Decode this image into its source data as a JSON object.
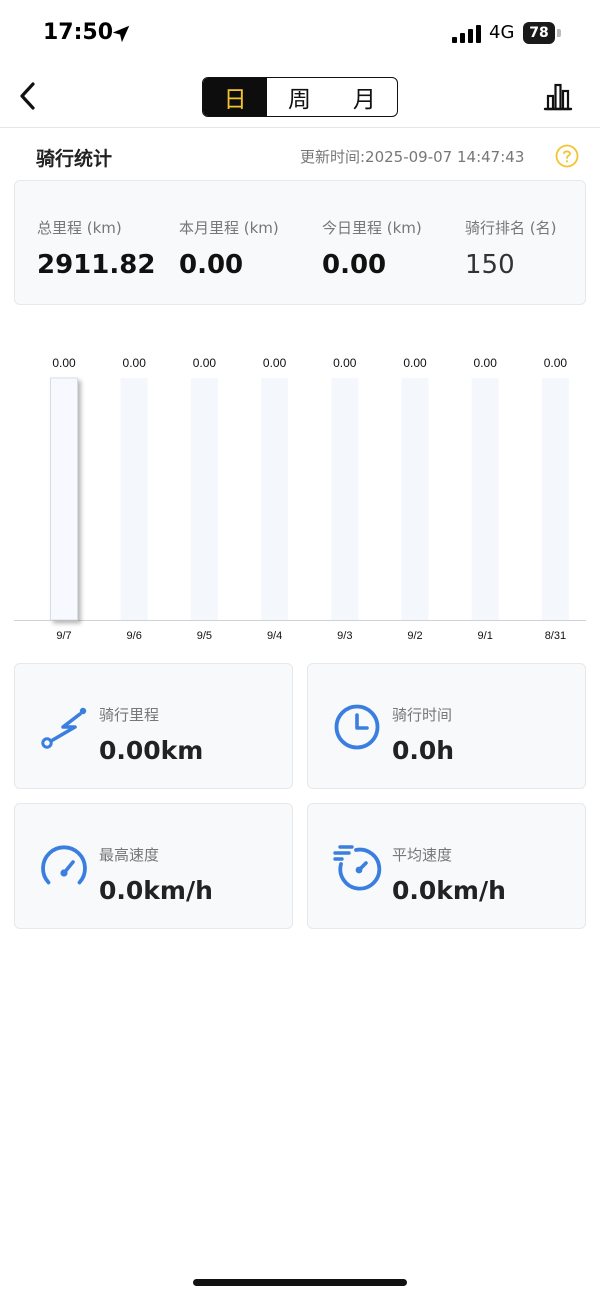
{
  "status_bar": {
    "time": "17:50",
    "network": "4G",
    "battery": "78"
  },
  "nav": {
    "tabs": [
      {
        "label": "日",
        "active": true
      },
      {
        "label": "周",
        "active": false
      },
      {
        "label": "月",
        "active": false
      }
    ],
    "icons": {
      "back": "chevron-left-icon",
      "stats": "bar-chart-icon"
    }
  },
  "header": {
    "title": "骑行统计",
    "update_time": "更新时间:2025-09-07 14:47:43",
    "help_icon": "question-circle-icon"
  },
  "summary": [
    {
      "label": "总里程 (km)",
      "value": "2911.82"
    },
    {
      "label": "本月里程 (km)",
      "value": "0.00"
    },
    {
      "label": "今日里程 (km)",
      "value": "0.00"
    },
    {
      "label": "骑行排名 (名)",
      "value": "150"
    }
  ],
  "chart_data": {
    "type": "bar",
    "categories": [
      "9/7",
      "9/6",
      "9/5",
      "9/4",
      "9/3",
      "9/2",
      "9/1",
      "8/31"
    ],
    "values": [
      0,
      0,
      0,
      0,
      0,
      0,
      0,
      0
    ],
    "labels": [
      "0.00",
      "0.00",
      "0.00",
      "0.00",
      "0.00",
      "0.00",
      "0.00",
      "0.00"
    ],
    "selected_index": 0
  },
  "metrics": [
    {
      "label": "骑行里程",
      "value": "0.00km",
      "icon": "route-icon"
    },
    {
      "label": "骑行时间",
      "value": "0.0h",
      "icon": "clock-icon"
    },
    {
      "label": "最高速度",
      "value": "0.0km/h",
      "icon": "speedometer-icon"
    },
    {
      "label": "平均速度",
      "value": "0.0km/h",
      "icon": "fast-timer-icon"
    }
  ],
  "colors": {
    "accent": "#f4c430",
    "icon_blue": "#3a7fe0",
    "card_bg": "#f8f9fa"
  }
}
